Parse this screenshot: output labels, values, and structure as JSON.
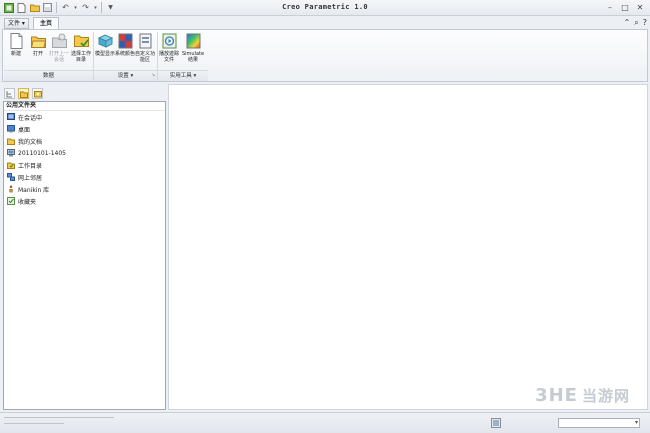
{
  "window": {
    "title": "Creo Parametric 1.0"
  },
  "tabs": {
    "file": "文件 ▾",
    "home": "主页"
  },
  "ribbon": {
    "buttons": [
      {
        "id": "new",
        "label": "新建"
      },
      {
        "id": "open",
        "label": "打开"
      },
      {
        "id": "open-last",
        "label": "打开上一会话",
        "disabled": true
      },
      {
        "id": "select-dir",
        "label": "选择工作目录"
      },
      {
        "id": "model-display",
        "label": "模型显示"
      },
      {
        "id": "system-colors",
        "label": "系统颜色"
      },
      {
        "id": "custom-ribbon",
        "label": "自定义功能区"
      },
      {
        "id": "erase-files",
        "label": "播放迹踪文件"
      },
      {
        "id": "simulate-results",
        "label": "Simulate结果"
      }
    ],
    "groups": {
      "data": "数据",
      "settings": "设置 ▾",
      "utilities": "实用工具 ▾"
    }
  },
  "navigator": {
    "header": "公用文件夹",
    "items": [
      {
        "label": "在会话中",
        "icon": "session-icon"
      },
      {
        "label": "桌面",
        "icon": "desktop-icon"
      },
      {
        "label": "我的文档",
        "icon": "my-documents-icon"
      },
      {
        "label": "20110101-1405",
        "icon": "computer-icon"
      },
      {
        "label": "工作目录",
        "icon": "work-folder-icon"
      },
      {
        "label": "网上邻居",
        "icon": "network-icon"
      },
      {
        "label": "Manikin 库",
        "icon": "manikin-icon"
      },
      {
        "label": "收藏夹",
        "icon": "favorites-icon"
      }
    ]
  },
  "watermark": {
    "main": "3HE",
    "sub": "当游网"
  },
  "colors": {
    "accent": "#2f6db5",
    "workspace": "#ffffff",
    "chrome": "#eceff3"
  }
}
